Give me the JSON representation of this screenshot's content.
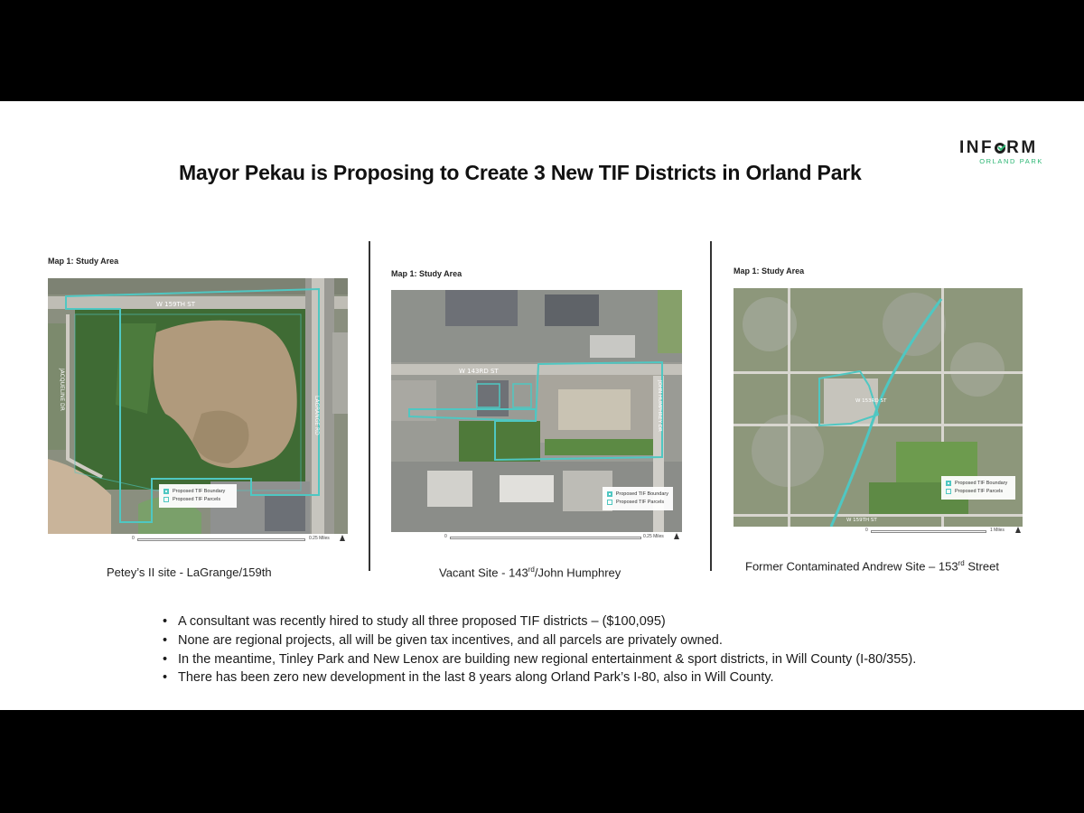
{
  "slide": {
    "title": "Mayor Pekau is Proposing to Create 3 New TIF Districts in Orland Park",
    "logo": {
      "main": "INFORM",
      "sub": "ORLAND PARK",
      "accent_color": "#2bb673"
    },
    "boundary_color": "#4fc7c2",
    "maps": [
      {
        "label": "Map 1: Study Area",
        "street_labels": [
          "W 159TH ST",
          "LAGRANGE RD",
          "JACQUELINE DR"
        ],
        "legend": [
          "Proposed TIF Boundary",
          "Proposed TIF Parcels"
        ],
        "scale_start": "0",
        "scale_end": "0.25 Miles",
        "caption": "Petey’s II site -  LaGrange/159th"
      },
      {
        "label": "Map 1: Study Area",
        "street_labels": [
          "W 143RD ST",
          "JOHN HUMPHREY DR"
        ],
        "legend": [
          "Proposed TIF Boundary",
          "Proposed TIF Parcels"
        ],
        "scale_start": "0",
        "scale_end": "0.25 Miles",
        "caption_pre": "Vacant Site - 143",
        "caption_sup": "rd",
        "caption_post": "/John Humphrey"
      },
      {
        "label": "Map 1: Study Area",
        "street_labels": [
          "W 153RD ST",
          "W 159TH ST"
        ],
        "legend": [
          "Proposed TIF Boundary",
          "Proposed TIF Parcels"
        ],
        "scale_start": "0",
        "scale_end": "1 Miles",
        "caption_pre": "Former Contaminated Andrew Site – 153",
        "caption_sup": "rd",
        "caption_post": " Street"
      }
    ],
    "bullets": [
      "A consultant was recently hired to study all three proposed TIF districts – ($100,095)",
      "None are regional projects, all will be given tax incentives, and all parcels are privately owned.",
      "In the meantime, Tinley Park and New Lenox are building new regional entertainment & sport districts, in Will County (I-80/355).",
      "There has been zero new development in the last 8 years along Orland Park’s I-80,  also in Will County."
    ]
  }
}
